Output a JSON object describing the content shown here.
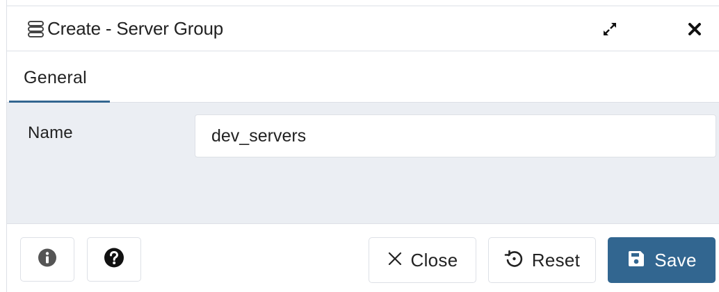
{
  "dialog": {
    "title": "Create - Server Group",
    "title_icon": "server-group-icon",
    "maximize_icon": "expand-arrows-icon",
    "close_icon": "close-x-icon"
  },
  "tabs": [
    {
      "label": "General",
      "active": true
    }
  ],
  "form": {
    "name_label": "Name",
    "name_value": "dev_servers"
  },
  "footer": {
    "info_icon": "info-icon",
    "help_icon": "help-icon",
    "close_label": "Close",
    "reset_label": "Reset",
    "save_label": "Save"
  },
  "colors": {
    "accent": "#326690",
    "content_bg": "#ebeef3",
    "border": "#dde0e6",
    "text": "#222222"
  }
}
